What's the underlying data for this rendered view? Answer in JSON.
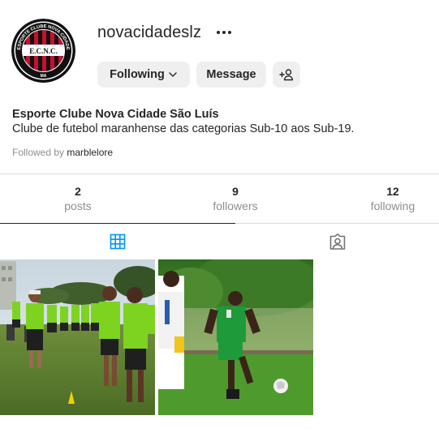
{
  "profile": {
    "username": "novacidadeslz",
    "display_name": "Esporte Clube Nova Cidade São Luís",
    "bio": "Clube de futebol maranhense das categorias Sub-10 aos Sub-19.",
    "followed_by_prefix": "Followed by",
    "followed_by_user": "marblelore",
    "avatar": {
      "ring_text": "ESPORTE CLUBE NOVA CIDADE",
      "center_text": "E.C.N.C.",
      "bottom_text": "MA"
    }
  },
  "actions": {
    "following_label": "Following",
    "message_label": "Message"
  },
  "stats": {
    "posts": {
      "value": "2",
      "label": "posts"
    },
    "followers": {
      "value": "9",
      "label": "followers"
    },
    "following": {
      "value": "12",
      "label": "following"
    }
  },
  "tabs": [
    {
      "name": "posts-grid",
      "icon": "grid-icon",
      "active": true
    },
    {
      "name": "tagged",
      "icon": "tagged-icon",
      "active": false
    }
  ],
  "colors": {
    "brand_red": "#c8102e",
    "button_bg": "#efefef",
    "text": "#262626",
    "muted": "#8e8e8e",
    "active_tab_icon": "#0095f6",
    "divider": "#dbdbdb"
  }
}
